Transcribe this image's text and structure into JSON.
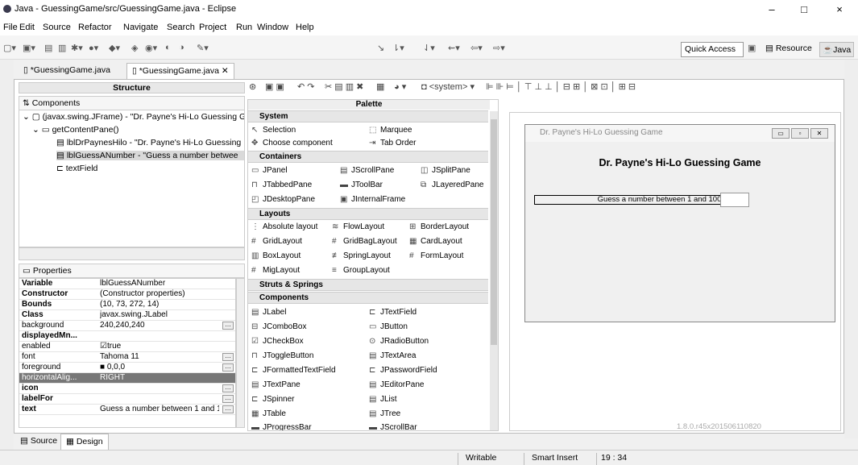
{
  "window": {
    "title": "Java - GuessingGame/src/GuessingGame.java - Eclipse",
    "minimize": "–",
    "maximize": "□",
    "close": "×"
  },
  "menu": [
    "File",
    "Edit",
    "Source",
    "Refactor",
    "Navigate",
    "Search",
    "Project",
    "Run",
    "Window",
    "Help"
  ],
  "toolbar": {
    "quick_access": "Quick Access",
    "perspectives": [
      "Resource",
      "Java"
    ]
  },
  "editor_tabs": [
    "*GuessingGame.java",
    "*GuessingGame.java"
  ],
  "structure": {
    "title": "Structure",
    "components_label": "Components",
    "tree": [
      "(javax.swing.JFrame) - \"Dr. Payne's Hi-Lo Guessing G",
      "getContentPane()",
      "lblDrPaynesHilo - \"Dr. Payne's Hi-Lo Guessing",
      "lblGuessANumber - \"Guess a number betwee",
      "textField"
    ]
  },
  "properties": {
    "title": "Properties",
    "rows": [
      {
        "k": "Variable",
        "v": "lblGuessANumber"
      },
      {
        "k": "Constructor",
        "v": "(Constructor properties)"
      },
      {
        "k": "Bounds",
        "v": "(10, 73, 272, 14)"
      },
      {
        "k": "Class",
        "v": "javax.swing.JLabel"
      },
      {
        "k": "background",
        "v": "240,240,240"
      },
      {
        "k": "displayedMn...",
        "v": ""
      },
      {
        "k": "enabled",
        "v": "true"
      },
      {
        "k": "font",
        "v": "Tahoma 11"
      },
      {
        "k": "foreground",
        "v": "0,0,0"
      },
      {
        "k": "horizontalAlig...",
        "v": "RIGHT"
      },
      {
        "k": "icon",
        "v": ""
      },
      {
        "k": "labelFor",
        "v": ""
      },
      {
        "k": "text",
        "v": "Guess a number between 1 and 1..."
      }
    ]
  },
  "palette": {
    "title": "Palette",
    "categories": [
      "System",
      "Containers",
      "Layouts",
      "Struts & Springs",
      "Components"
    ],
    "system": [
      "Selection",
      "Marquee",
      "Choose component",
      "Tab Order"
    ],
    "containers": [
      "JPanel",
      "JScrollPane",
      "JSplitPane",
      "JTabbedPane",
      "JToolBar",
      "JLayeredPane",
      "JDesktopPane",
      "JInternalFrame"
    ],
    "layouts": [
      "Absolute layout",
      "FlowLayout",
      "BorderLayout",
      "GridLayout",
      "GridBagLayout",
      "CardLayout",
      "BoxLayout",
      "SpringLayout",
      "FormLayout",
      "MigLayout",
      "GroupLayout"
    ],
    "components": [
      "JLabel",
      "JTextField",
      "JComboBox",
      "JButton",
      "JCheckBox",
      "JRadioButton",
      "JToggleButton",
      "JTextArea",
      "JFormattedTextField",
      "JPasswordField",
      "JTextPane",
      "JEditorPane",
      "JSpinner",
      "JList",
      "JTable",
      "JTree",
      "JProgressBar",
      "JScrollBar"
    ]
  },
  "system_combo": "<system>",
  "design": {
    "frame_title": "Dr. Payne's Hi-Lo Guessing Game",
    "heading": "Dr. Payne's Hi-Lo Guessing Game",
    "label": "Guess a number between 1 and 100:",
    "version": "1.8.0.r45x201506110820"
  },
  "bottom_tabs": [
    "Source",
    "Design"
  ],
  "status": {
    "writable": "Writable",
    "insert": "Smart Insert",
    "position": "19 : 34"
  }
}
